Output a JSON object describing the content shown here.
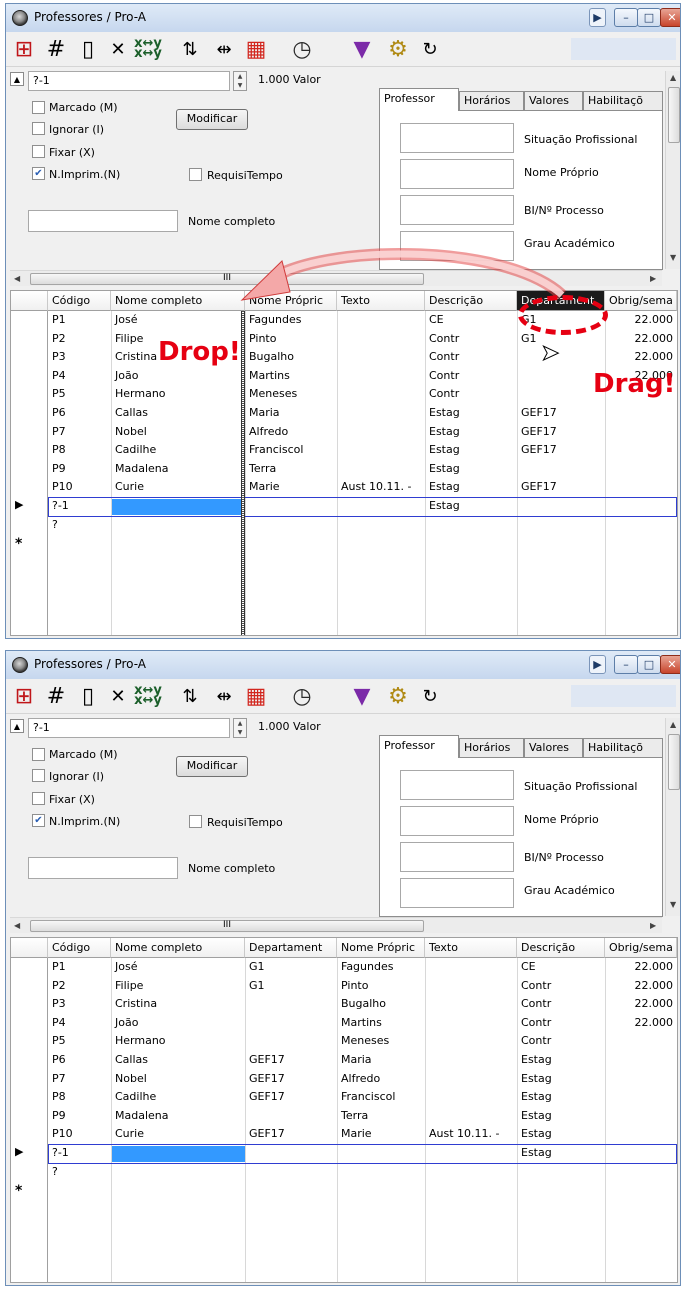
{
  "window_title": "Professores / Pro-A",
  "toolbar_icons": [
    "grid-select-icon",
    "hash-icon",
    "new-document-icon",
    "delete-icon",
    "swap-xy-icon",
    "sort-az-icon",
    "column-width-icon",
    "chart-icon",
    "clock-icon",
    "paint-cup-icon",
    "gears-icon",
    "refresh-icon"
  ],
  "top_panel": {
    "current_record": "?-1",
    "valor_label": "1.000 Valor",
    "checkboxes": [
      {
        "label": "Marcado (M)",
        "checked": false
      },
      {
        "label": "Ignorar (I)",
        "checked": false
      },
      {
        "label": "Fixar (X)",
        "checked": false
      },
      {
        "label": "N.Imprim.(N)",
        "checked": true
      }
    ],
    "modify_button": "Modificar",
    "requisitempo": "RequisiTempo",
    "nome_completo_label": "Nome completo",
    "tabs": [
      "Professor",
      "Horários",
      "Valores",
      "Habilitaçõ"
    ],
    "fields": [
      "Situação Profissional",
      "Nome Próprio",
      "BI/Nº Processo",
      "Grau Académico"
    ],
    "hscroll_grip": "III"
  },
  "grid_before": {
    "headers": [
      "Código",
      "Nome completo",
      "Nome Própric",
      "Texto",
      "Descrição",
      "Departament",
      "Obrig/sema"
    ],
    "rows": [
      [
        "P1",
        "José",
        "Fagundes",
        "",
        "CE",
        "G1",
        "22.000"
      ],
      [
        "P2",
        "Filipe",
        "Pinto",
        "",
        "Contr",
        "G1",
        "22.000"
      ],
      [
        "P3",
        "Cristina",
        "Bugalho",
        "",
        "Contr",
        "",
        "22.000"
      ],
      [
        "P4",
        "João",
        "Martins",
        "",
        "Contr",
        "",
        "22.000"
      ],
      [
        "P5",
        "Hermano",
        "Meneses",
        "",
        "Contr",
        "",
        ""
      ],
      [
        "P6",
        "Callas",
        "Maria",
        "",
        "Estag",
        "GEF17",
        ""
      ],
      [
        "P7",
        "Nobel",
        "Alfredo",
        "",
        "Estag",
        "GEF17",
        ""
      ],
      [
        "P8",
        "Cadilhe",
        "Franciscol",
        "",
        "Estag",
        "GEF17",
        ""
      ],
      [
        "P9",
        "Madalena",
        "Terra",
        "",
        "Estag",
        "",
        ""
      ],
      [
        "P10",
        "Curie",
        "Marie",
        "Aust 10.11. -",
        "Estag",
        "GEF17",
        ""
      ],
      [
        "?-1",
        "",
        "",
        "",
        "Estag",
        "",
        ""
      ],
      [
        "?",
        "",
        "",
        "",
        "",
        "",
        ""
      ]
    ],
    "drop_label": "Drop!",
    "drag_label": "Drag!"
  },
  "grid_after": {
    "headers": [
      "Código",
      "Nome completo",
      "Departament",
      "Nome Própric",
      "Texto",
      "Descrição",
      "Obrig/sema"
    ],
    "rows": [
      [
        "P1",
        "José",
        "G1",
        "Fagundes",
        "",
        "CE",
        "22.000"
      ],
      [
        "P2",
        "Filipe",
        "G1",
        "Pinto",
        "",
        "Contr",
        "22.000"
      ],
      [
        "P3",
        "Cristina",
        "",
        "Bugalho",
        "",
        "Contr",
        "22.000"
      ],
      [
        "P4",
        "João",
        "",
        "Martins",
        "",
        "Contr",
        "22.000"
      ],
      [
        "P5",
        "Hermano",
        "",
        "Meneses",
        "",
        "Contr",
        ""
      ],
      [
        "P6",
        "Callas",
        "GEF17",
        "Maria",
        "",
        "Estag",
        ""
      ],
      [
        "P7",
        "Nobel",
        "GEF17",
        "Alfredo",
        "",
        "Estag",
        ""
      ],
      [
        "P8",
        "Cadilhe",
        "GEF17",
        "Franciscol",
        "",
        "Estag",
        ""
      ],
      [
        "P9",
        "Madalena",
        "",
        "Terra",
        "",
        "Estag",
        ""
      ],
      [
        "P10",
        "Curie",
        "GEF17",
        "Marie",
        "Aust 10.11. -",
        "Estag",
        ""
      ],
      [
        "?-1",
        "",
        "",
        "",
        "",
        "Estag",
        ""
      ],
      [
        "?",
        "",
        "",
        "",
        "",
        "",
        ""
      ]
    ]
  },
  "colors": {
    "accent_red": "#e60012",
    "selection_blue": "#3399ff",
    "row_border": "#2f3dd1"
  }
}
